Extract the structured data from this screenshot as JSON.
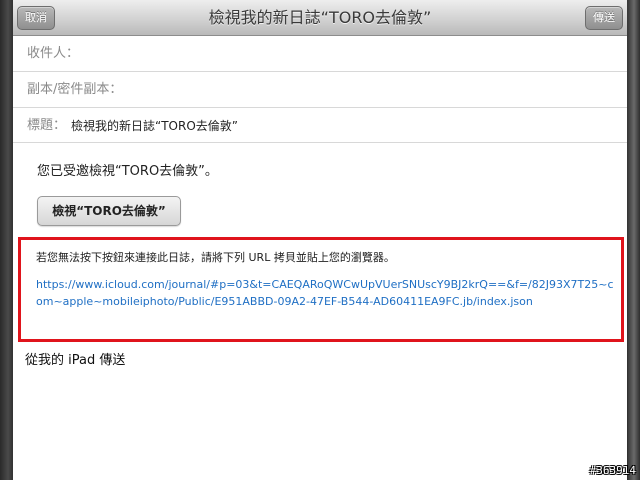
{
  "navbar": {
    "cancel_label": "取消",
    "title": "檢視我的新日誌“TORO去倫敦”",
    "send_label": "傳送"
  },
  "fields": {
    "to_label": "收件人：",
    "cc_label": "副本/密件副本：",
    "subject_label": "標題：",
    "subject_value": "檢視我的新日誌“TORO去倫敦”"
  },
  "message": {
    "invite_text": "您已受邀檢視“TORO去倫敦”。",
    "view_button_label": "檢視“TORO去倫敦”",
    "fallback_text": "若您無法按下按鈕來連接此日誌，請將下列 URL 拷貝並貼上您的瀏覽器。",
    "url": "https://www.icloud.com/journal/#p=03&t=CAEQARoQWCwUpVUerSNUscY9BJ2krQ==&f=/82J93X7T25~com~apple~mobileiphoto/Public/E951ABBD-09A2-47EF-B544-AD60411EA9FC.jb/index.json",
    "signature": "從我的 iPad 傳送"
  },
  "watermark": "#363914",
  "colors": {
    "highlight": "#e0141c",
    "link": "#1f6fc4"
  }
}
